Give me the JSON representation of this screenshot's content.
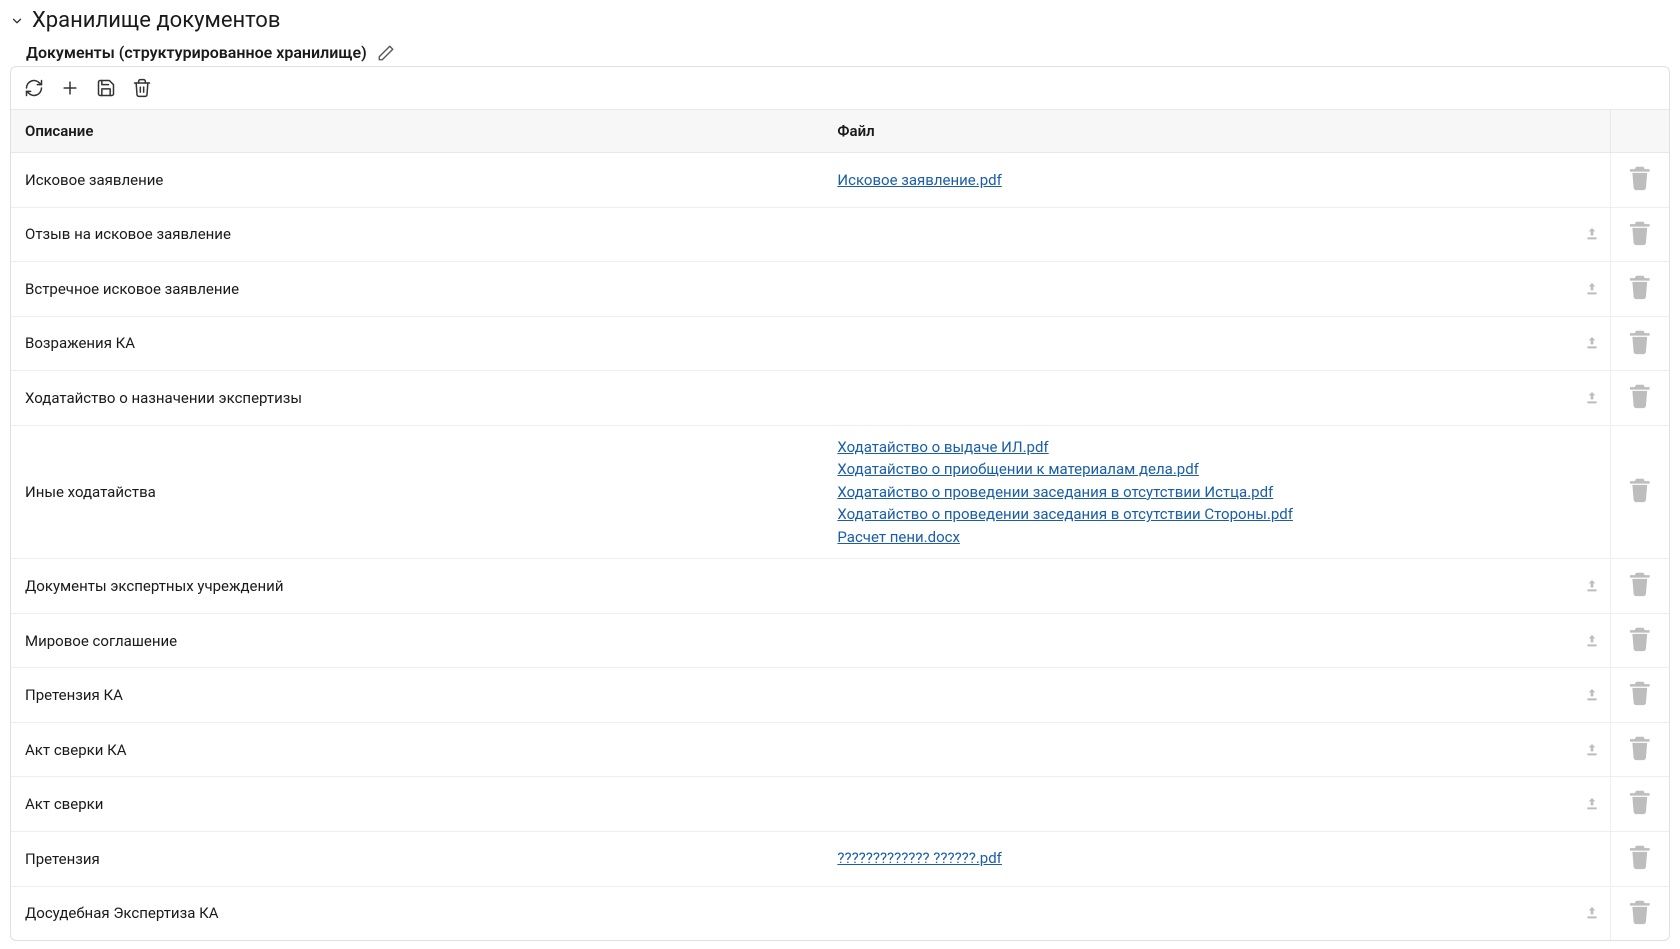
{
  "section": {
    "title": "Хранилище документов",
    "subtitle": "Документы (структурированное хранилище)"
  },
  "columns": {
    "description": "Описание",
    "file": "Файл"
  },
  "rows": [
    {
      "desc": "Исковое заявление",
      "files": [
        "Исковое заявление.pdf"
      ],
      "hasUpload": false
    },
    {
      "desc": "Отзыв на исковое заявление",
      "files": [],
      "hasUpload": true
    },
    {
      "desc": "Встречное исковое заявление",
      "files": [],
      "hasUpload": true
    },
    {
      "desc": "Возражения КА",
      "files": [],
      "hasUpload": true
    },
    {
      "desc": "Ходатайство о назначении экспертизы",
      "files": [],
      "hasUpload": true
    },
    {
      "desc": "Иные ходатайства",
      "files": [
        "Ходатайство о выдаче ИЛ.pdf",
        "Ходатайство о приобщении к материалам дела.pdf",
        "Ходатайство о проведении заседания в отсутствии Истца.pdf",
        "Ходатайство о проведении заседания в отсутствии Стороны.pdf",
        "Расчет пени.docx"
      ],
      "hasUpload": false
    },
    {
      "desc": "Документы экспертных учреждений",
      "files": [],
      "hasUpload": true
    },
    {
      "desc": "Мировое соглашение",
      "files": [],
      "hasUpload": true
    },
    {
      "desc": "Претензия КА",
      "files": [],
      "hasUpload": true
    },
    {
      "desc": "Акт сверки КА",
      "files": [],
      "hasUpload": true
    },
    {
      "desc": "Акт сверки",
      "files": [],
      "hasUpload": true
    },
    {
      "desc": "Претензия",
      "files": [
        "????????????? ??????.pdf"
      ],
      "hasUpload": false
    },
    {
      "desc": "Досудебная Экспертиза КА",
      "files": [],
      "hasUpload": true
    }
  ]
}
